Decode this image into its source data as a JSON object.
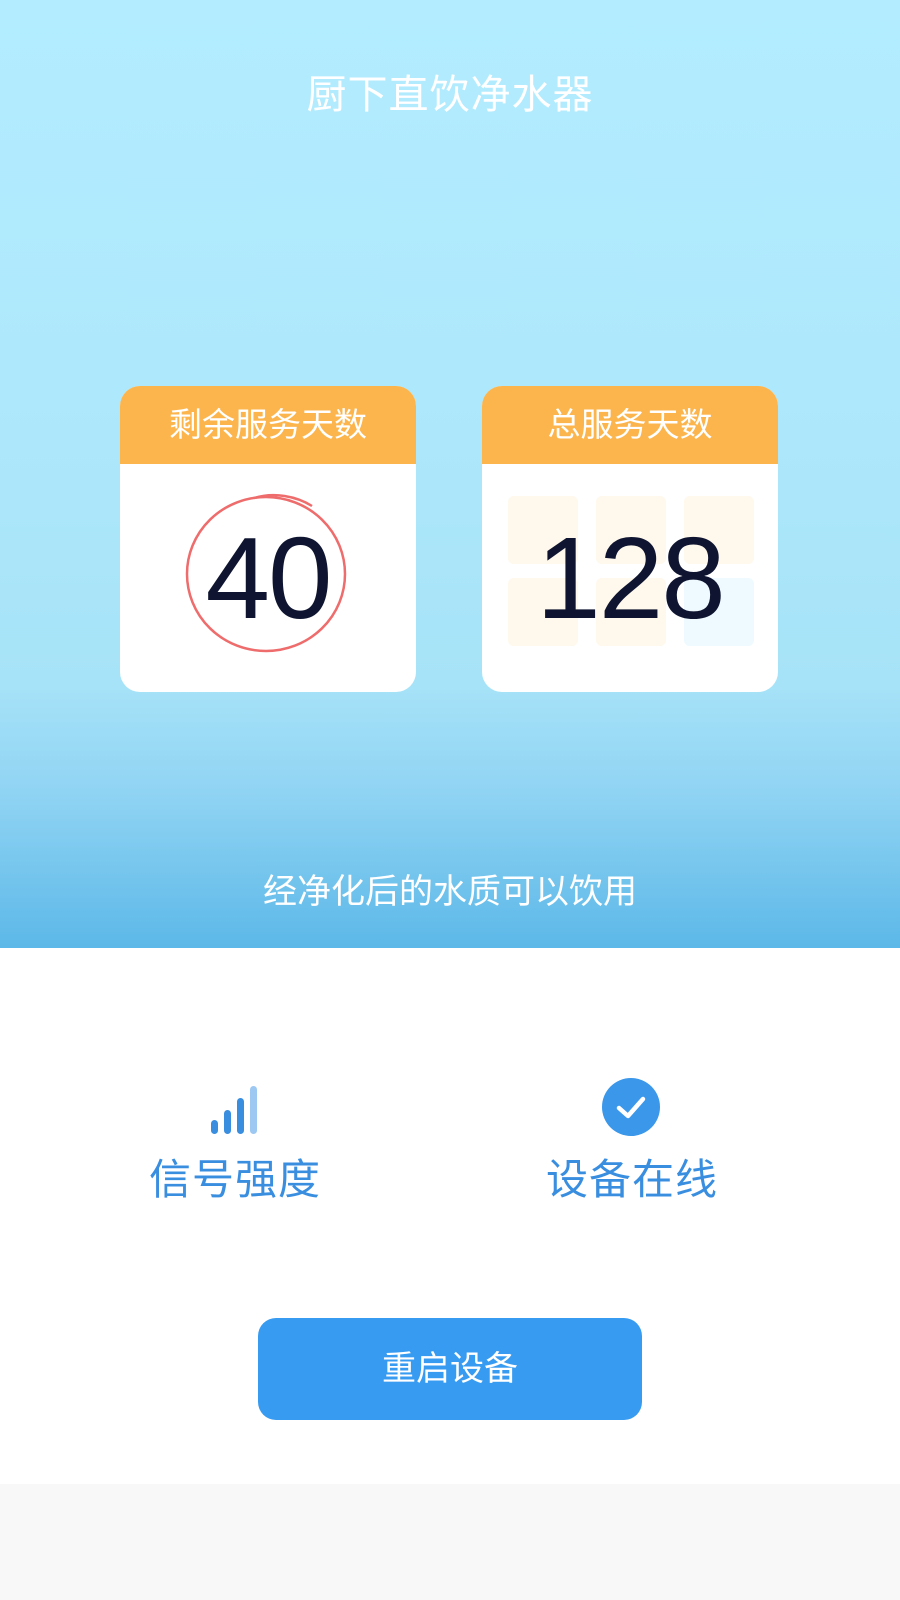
{
  "app": {
    "title": "厨下直饮净水器"
  },
  "cards": {
    "remaining": {
      "label": "剩余服务天数",
      "value": "40"
    },
    "total": {
      "label": "总服务天数",
      "value": "128"
    }
  },
  "water_quality_message": "经净化后的水质可以饮用",
  "status": {
    "signal": {
      "icon": "signal-strength-icon",
      "label": "信号强度"
    },
    "online": {
      "icon": "check-circle-icon",
      "label": "设备在线"
    }
  },
  "actions": {
    "restart_label": "重启设备"
  },
  "colors": {
    "card_header": "#fcb54c",
    "primary_blue": "#379bf1",
    "status_text": "#3a8ee0",
    "remaining_circle": "#ee6c6c"
  }
}
